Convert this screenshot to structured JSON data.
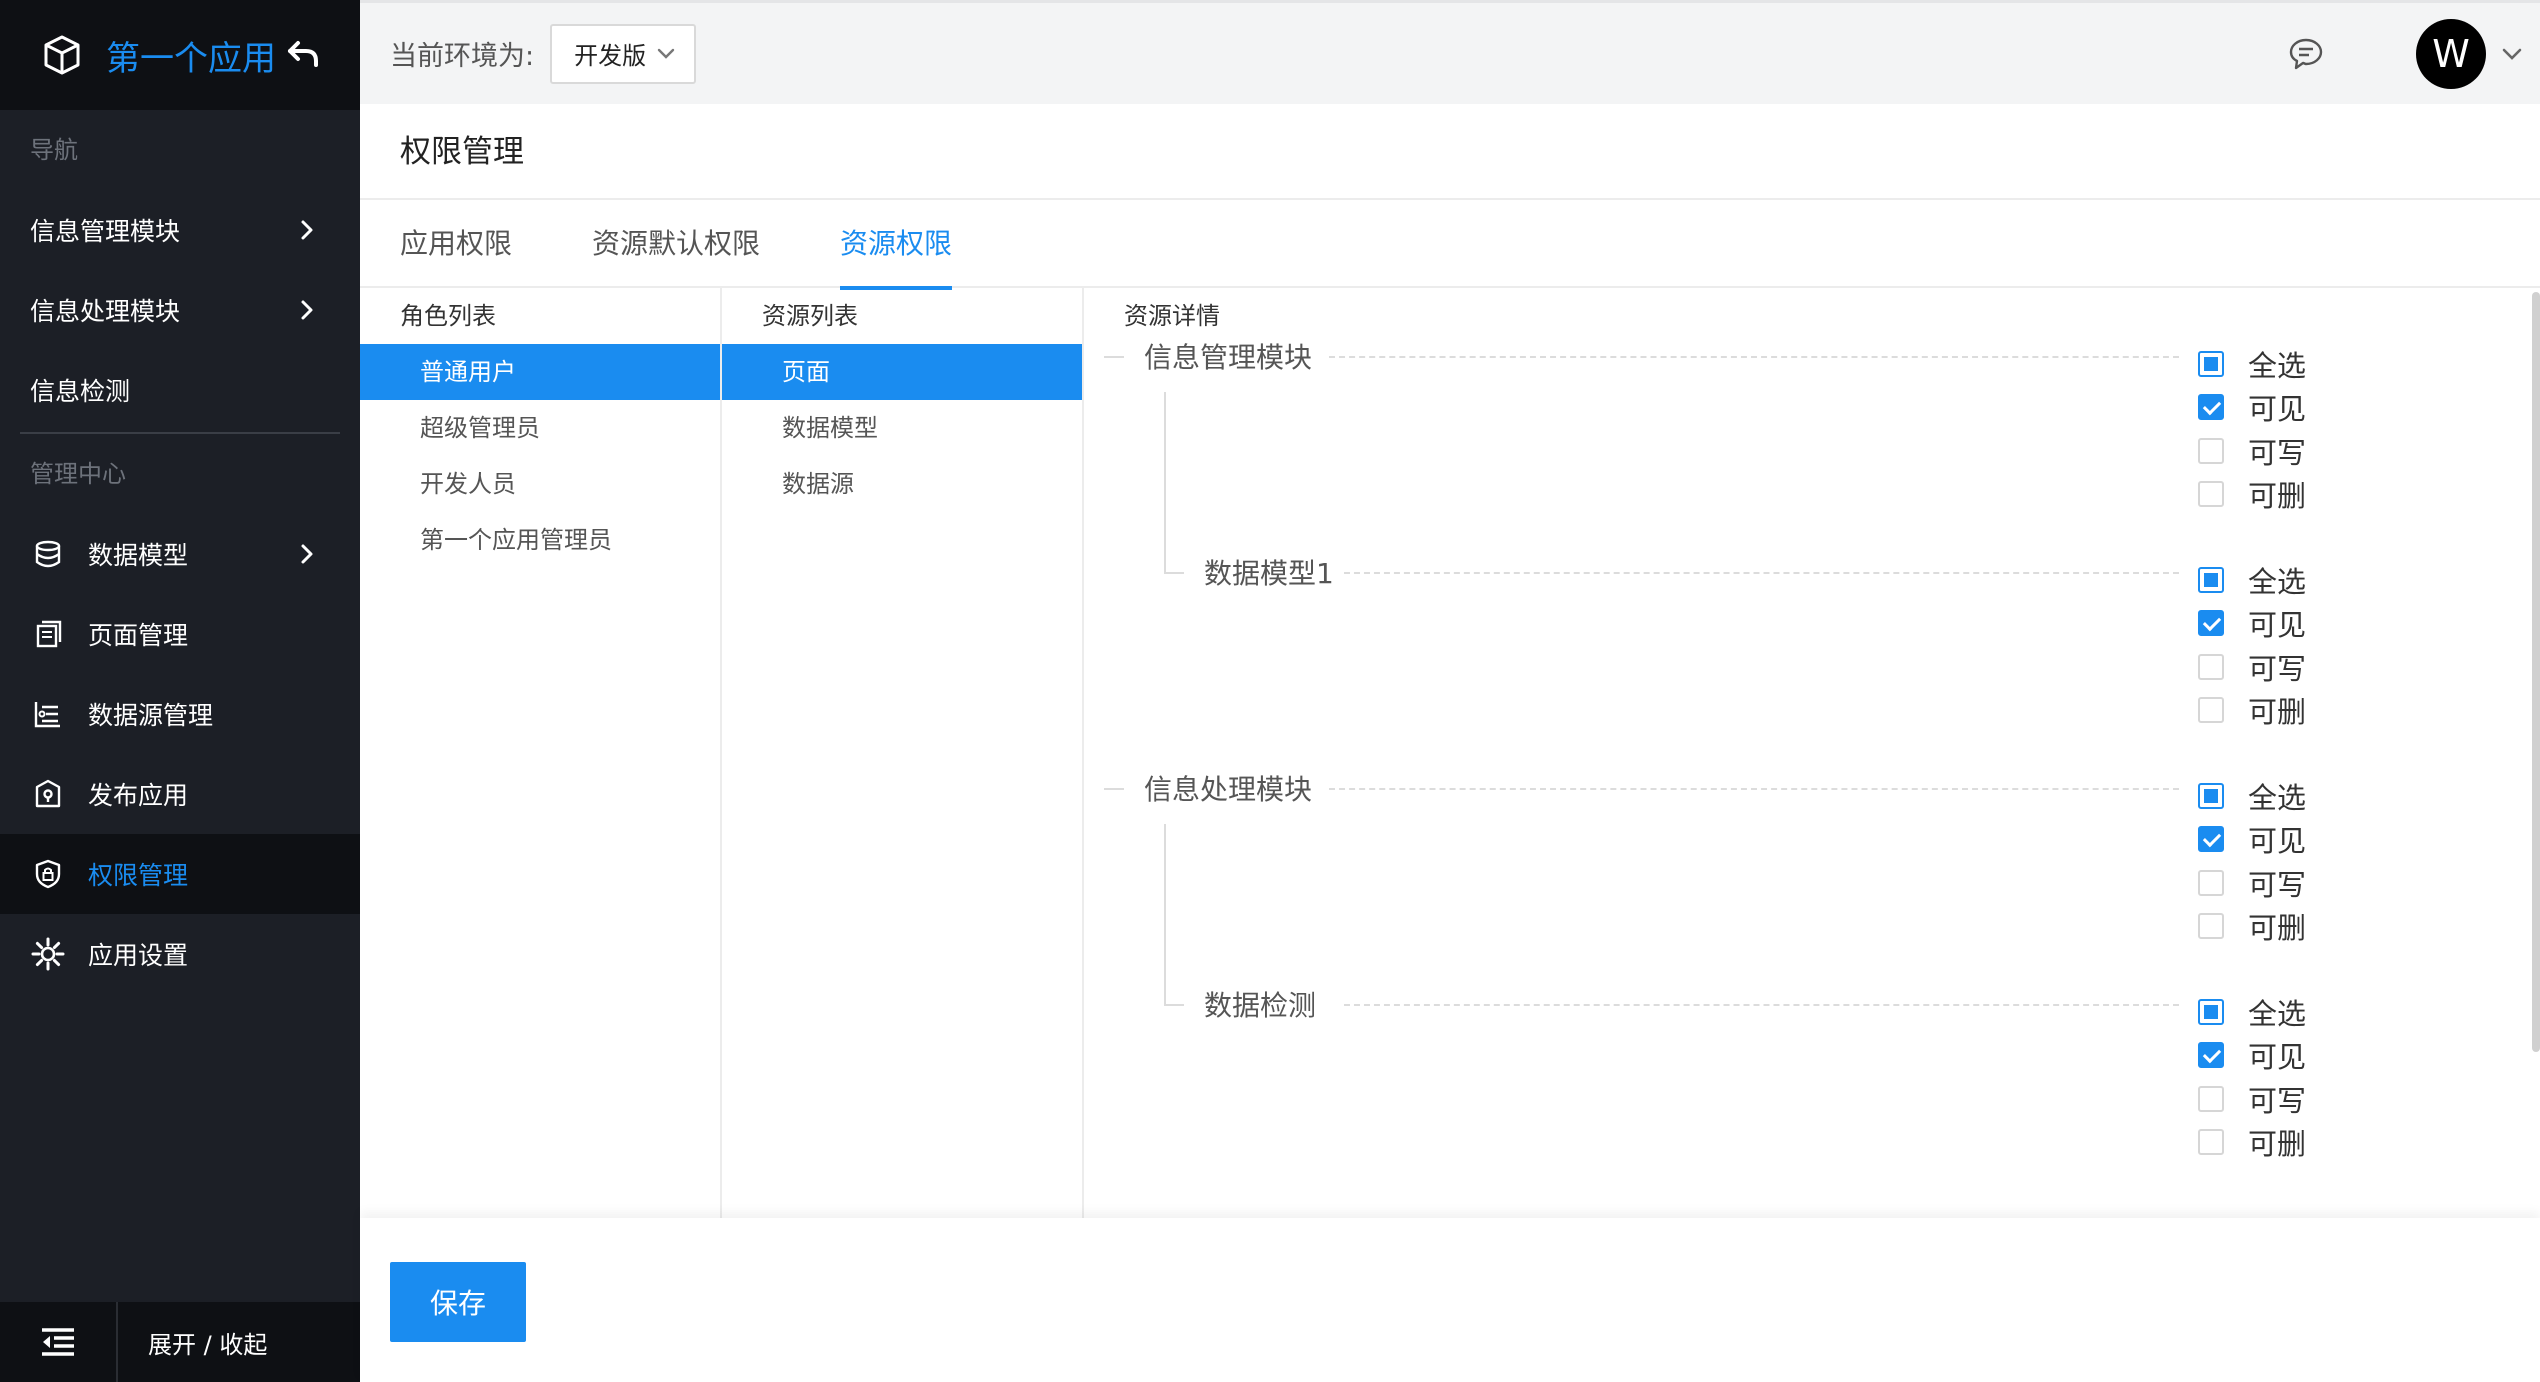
{
  "app": {
    "title": "第一个应用"
  },
  "sidebar": {
    "nav_group": "导航",
    "mgmt_group": "管理中心",
    "nav_items": [
      {
        "label": "信息管理模块",
        "has_children": true
      },
      {
        "label": "信息处理模块",
        "has_children": true
      },
      {
        "label": "信息检测",
        "has_children": false
      }
    ],
    "mgmt_items": [
      {
        "label": "数据模型",
        "icon": "database-icon",
        "has_children": true
      },
      {
        "label": "页面管理",
        "icon": "pages-icon",
        "has_children": false
      },
      {
        "label": "数据源管理",
        "icon": "datasource-icon",
        "has_children": false
      },
      {
        "label": "发布应用",
        "icon": "publish-icon",
        "has_children": false
      },
      {
        "label": "权限管理",
        "icon": "shield-icon",
        "active": true
      },
      {
        "label": "应用设置",
        "icon": "gear-icon",
        "has_children": false
      }
    ],
    "footer_label": "展开 / 收起"
  },
  "topbar": {
    "env_label": "当前环境为:",
    "env_value": "开发版",
    "avatar_letter": "W"
  },
  "page": {
    "title": "权限管理",
    "tabs": [
      "应用权限",
      "资源默认权限",
      "资源权限"
    ],
    "active_tab": 2
  },
  "roles": {
    "header": "角色列表",
    "items": [
      "普通用户",
      "超级管理员",
      "开发人员",
      "第一个应用管理员"
    ],
    "selected": 0
  },
  "resources": {
    "header": "资源列表",
    "items": [
      "页面",
      "数据模型",
      "数据源"
    ],
    "selected": 0
  },
  "detail": {
    "header": "资源详情",
    "nodes": [
      {
        "label": "信息管理模块",
        "level": 0,
        "checks": {
          "all": "partial",
          "view": true,
          "write": false,
          "delete": false
        }
      },
      {
        "label": "数据模型1",
        "level": 1,
        "checks": {
          "all": "partial",
          "view": true,
          "write": false,
          "delete": false
        }
      },
      {
        "label": "信息处理模块",
        "level": 0,
        "checks": {
          "all": "partial",
          "view": true,
          "write": false,
          "delete": false
        }
      },
      {
        "label": "数据检测",
        "level": 1,
        "checks": {
          "all": "partial",
          "view": true,
          "write": false,
          "delete": false
        }
      }
    ],
    "check_labels": [
      "全选",
      "可见",
      "可写",
      "可删"
    ]
  },
  "actions": {
    "save_label": "保存"
  },
  "colors": {
    "accent": "#1a8cf0",
    "sidebar_bg": "#1c1f26",
    "sidebar_dark": "#0e1014"
  }
}
